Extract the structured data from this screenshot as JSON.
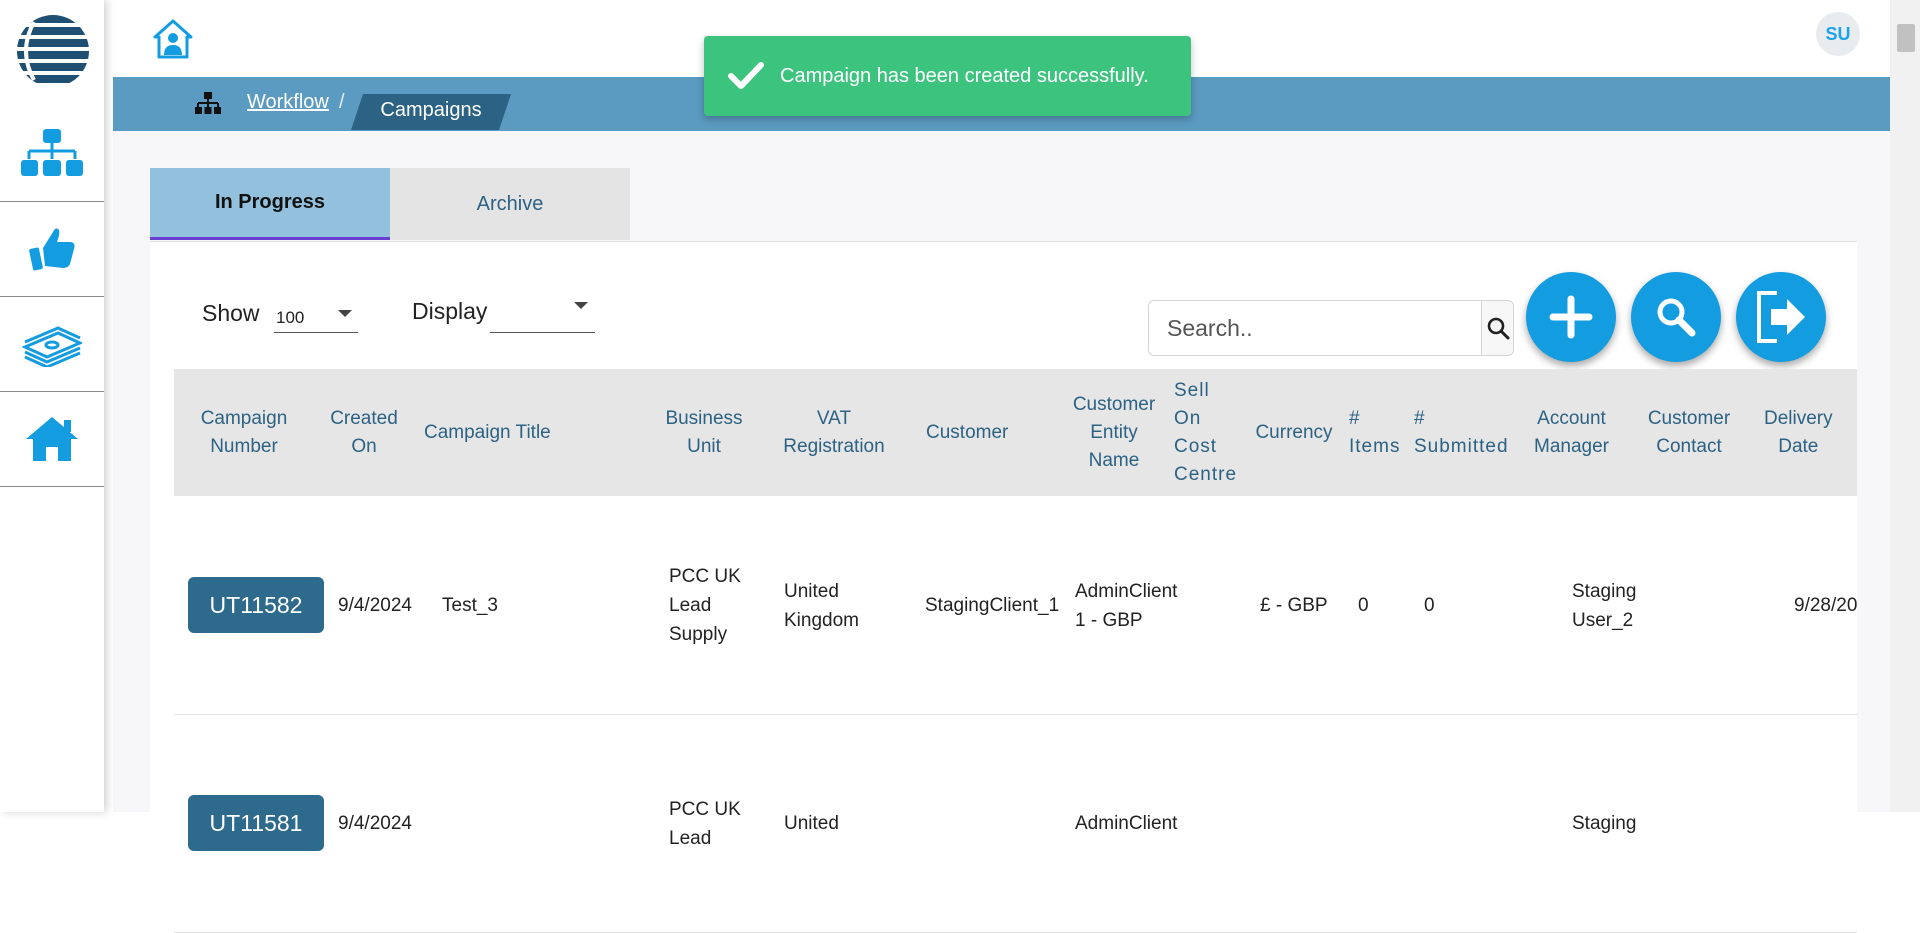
{
  "header": {
    "avatar_initials": "SU",
    "home_icon": "house-user-icon"
  },
  "sidebar": {
    "logo": "globe-logo",
    "items": [
      {
        "name": "workflow",
        "icon": "hierarchy-icon"
      },
      {
        "name": "approvals",
        "icon": "thumbs-up-icon"
      },
      {
        "name": "finance",
        "icon": "money-stack-icon"
      },
      {
        "name": "home",
        "icon": "home-icon"
      }
    ]
  },
  "breadcrumb": {
    "icon": "sitemap-icon",
    "parent": "Workflow",
    "separator": "/",
    "current": "Campaigns"
  },
  "toast": {
    "message": "Campaign has been created successfully.",
    "icon": "checkmark-icon",
    "color": "#3cc47f"
  },
  "tabs": [
    {
      "label": "In Progress",
      "active": true
    },
    {
      "label": "Archive",
      "active": false
    }
  ],
  "controls": {
    "show_label": "Show",
    "show_value": "100",
    "display_label": "Display",
    "display_value": "",
    "search_placeholder": "Search.."
  },
  "actions": [
    {
      "name": "add",
      "icon": "plus-icon"
    },
    {
      "name": "search",
      "icon": "magnifier-icon"
    },
    {
      "name": "export",
      "icon": "sign-out-icon"
    }
  ],
  "table": {
    "columns": [
      "Campaign\nNumber",
      "Created\nOn",
      "Campaign Title",
      "Business\nUnit",
      "VAT\nRegistration",
      "Customer",
      "Customer\nEntity\nName",
      "Sell\nOn\nCost\nCentre",
      "Currency",
      "#\nItems",
      "#\nSubmitted",
      "Account\nManager",
      "Customer\nContact",
      "Delivery\nDate"
    ],
    "rows": [
      {
        "campaign_number": "UT11582",
        "created_on": "9/4/2024",
        "title": "Test_3",
        "business_unit": "PCC UK\nLead\nSupply",
        "vat_registration": "United\nKingdom",
        "customer": "StagingClient_1",
        "customer_entity": "AdminClient\n1 - GBP",
        "sell_on_cost_centre": "",
        "currency": "£ - GBP",
        "items": "0",
        "submitted": "0",
        "account_manager": "Staging\nUser_2",
        "customer_contact": "",
        "delivery_date": "9/28/20"
      },
      {
        "campaign_number": "UT11581",
        "created_on": "9/4/2024",
        "title": "",
        "business_unit": "PCC UK\nLead",
        "vat_registration": "United",
        "customer": "",
        "customer_entity": "AdminClient",
        "sell_on_cost_centre": "",
        "currency": "",
        "items": "",
        "submitted": "",
        "account_manager": "Staging",
        "customer_contact": "",
        "delivery_date": ""
      }
    ]
  },
  "colors": {
    "accent": "#139ce0",
    "breadcrumb_bar": "#5b9ac1",
    "primary_dark": "#2c6283",
    "active_tab": "#93c1dd"
  }
}
